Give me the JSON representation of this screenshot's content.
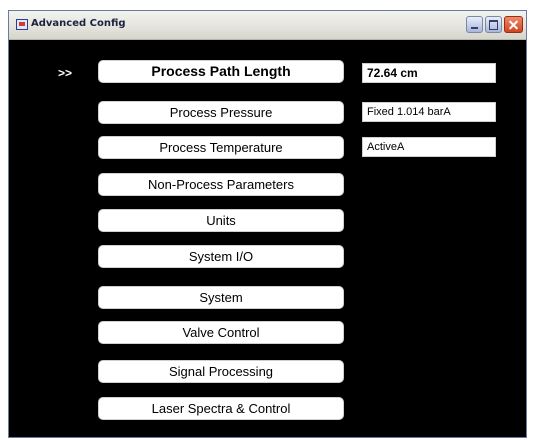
{
  "window": {
    "title": "Advanced Config",
    "icon": "app-icon"
  },
  "indicator": ">>",
  "menu": {
    "items": [
      {
        "label": "Process Path Length",
        "selected": true
      },
      {
        "label": "Process Pressure"
      },
      {
        "label": "Process Temperature"
      },
      {
        "label": "Non-Process Parameters"
      },
      {
        "label": "Units"
      },
      {
        "label": "System I/O"
      },
      {
        "label": "System"
      },
      {
        "label": "Valve Control"
      },
      {
        "label": "Signal Processing"
      },
      {
        "label": "Laser Spectra & Control"
      }
    ]
  },
  "values": {
    "path_length": "72.64 cm",
    "pressure": "Fixed 1.014 barA",
    "temperature": "ActiveA"
  },
  "colors": {
    "panel_background": "#000000",
    "button_background": "#ffffff",
    "close_button": "#d0451e"
  }
}
